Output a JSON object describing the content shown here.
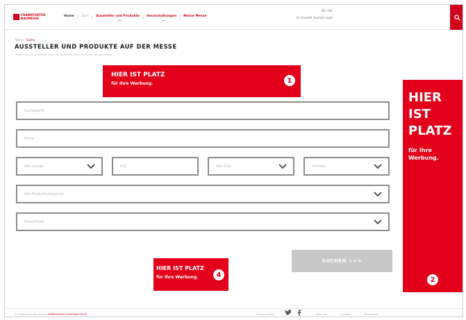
{
  "header": {
    "logo_text": "FRANKFURTER BAUMESSE",
    "nav": [
      {
        "label": "Home",
        "style": "normal"
      },
      {
        "label": "Start",
        "style": "muted"
      },
      {
        "label": "Aussteller und Produkte",
        "style": "red"
      },
      {
        "label": "Veranstaltungen",
        "style": "red"
      },
      {
        "label": "Meine Messe",
        "style": "red"
      }
    ],
    "language": "DE / EN",
    "top_links": "Ihr Ausstell. Kontakt Login",
    "colors": {
      "accent": "#e2001a",
      "brand": "#d0021b"
    }
  },
  "breadcrumb": {
    "home": "Home",
    "current": "Suche"
  },
  "page": {
    "title": "AUSSTELLER UND PRODUKTE AUF DER MESSE",
    "subtitle": "Finden Sie die Aussteller bzw. die Aussteller ihrer Produkte auf der Messe"
  },
  "ads": {
    "ad1": {
      "headline": "HIER IST PLATZ",
      "sub": "für Ihre Werbung.",
      "number": "1"
    },
    "ad2": {
      "headline": "HIER IST PLATZ",
      "sub": "für Ihre Werbung.",
      "number": "2"
    },
    "ad4": {
      "headline": "HIER IST PLATZ",
      "sub": "für Ihre Werbung.",
      "number": "4"
    }
  },
  "form": {
    "search_placeholder": "Suchbegriff",
    "place_placeholder": "Firma",
    "country_value": "Alle Länder",
    "zip_placeholder": "PLZ",
    "region_value": "Alle Orte",
    "radius_value": "Umkreis",
    "category_value": "Alle Produktkategorien",
    "event_value": "Event/Halle",
    "submit_label": "SUCHEN >>>"
  },
  "footer": {
    "copyright": "© Frankfurter Baumesse",
    "copyright_link": "IMPRESSUM & DATENSCHUTZ",
    "links": [
      "Privacy Policy",
      "Über uns",
      "Kontakt",
      "Newsletter"
    ]
  }
}
